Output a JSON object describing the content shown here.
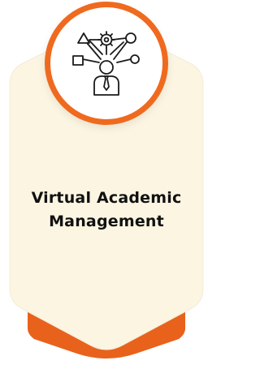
{
  "card": {
    "title_line_1": "Virtual Academic",
    "title_line_2": "Management",
    "icon": "network-person-icon",
    "colors": {
      "accent": "#ef6a1f",
      "accent_dark": "#e0561a",
      "card_fill": "#fbf5e2",
      "icon_stroke": "#1a1a1a"
    }
  }
}
